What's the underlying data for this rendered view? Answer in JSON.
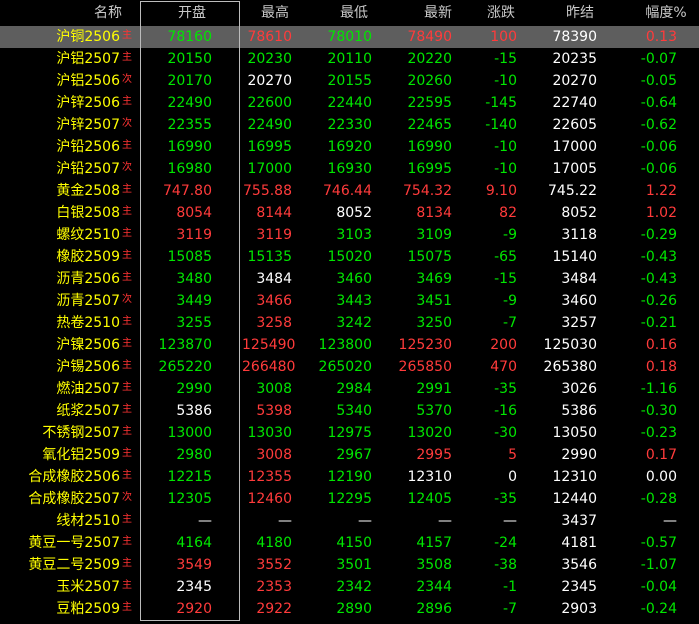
{
  "colors": {
    "background": "#000000",
    "name": "#ffff00",
    "up": "#ff3b3b",
    "down": "#00e600",
    "flat": "#ffffff",
    "tag": "#ff3333",
    "header": "#c8c8c8",
    "selected_row": "#5e5e5e"
  },
  "columns": {
    "name": "名称",
    "open": "开盘",
    "high": "最高",
    "low": "最低",
    "last": "最新",
    "change": "涨跌",
    "prev_close": "昨结",
    "pct": "幅度%"
  },
  "selected_row_index": 0,
  "rows": [
    {
      "name": "沪铜2506",
      "tag": "主",
      "open": "78160",
      "open_c": "down",
      "high": "78610",
      "high_c": "up",
      "low": "78010",
      "low_c": "down",
      "last": "78490",
      "last_c": "up",
      "change": "100",
      "change_c": "up",
      "prev": "78390",
      "pct": "0.13",
      "pct_c": "up"
    },
    {
      "name": "沪铝2507",
      "tag": "主",
      "open": "20150",
      "open_c": "down",
      "high": "20230",
      "high_c": "down",
      "low": "20110",
      "low_c": "down",
      "last": "20220",
      "last_c": "down",
      "change": "-15",
      "change_c": "down",
      "prev": "20235",
      "pct": "-0.07",
      "pct_c": "down"
    },
    {
      "name": "沪铝2506",
      "tag": "次",
      "open": "20170",
      "open_c": "down",
      "high": "20270",
      "high_c": "flat",
      "low": "20155",
      "low_c": "down",
      "last": "20260",
      "last_c": "down",
      "change": "-10",
      "change_c": "down",
      "prev": "20270",
      "pct": "-0.05",
      "pct_c": "down"
    },
    {
      "name": "沪锌2506",
      "tag": "主",
      "open": "22490",
      "open_c": "down",
      "high": "22600",
      "high_c": "down",
      "low": "22440",
      "low_c": "down",
      "last": "22595",
      "last_c": "down",
      "change": "-145",
      "change_c": "down",
      "prev": "22740",
      "pct": "-0.64",
      "pct_c": "down"
    },
    {
      "name": "沪锌2507",
      "tag": "次",
      "open": "22355",
      "open_c": "down",
      "high": "22490",
      "high_c": "down",
      "low": "22330",
      "low_c": "down",
      "last": "22465",
      "last_c": "down",
      "change": "-140",
      "change_c": "down",
      "prev": "22605",
      "pct": "-0.62",
      "pct_c": "down"
    },
    {
      "name": "沪铅2506",
      "tag": "主",
      "open": "16990",
      "open_c": "down",
      "high": "16995",
      "high_c": "down",
      "low": "16920",
      "low_c": "down",
      "last": "16990",
      "last_c": "down",
      "change": "-10",
      "change_c": "down",
      "prev": "17000",
      "pct": "-0.06",
      "pct_c": "down"
    },
    {
      "name": "沪铅2507",
      "tag": "次",
      "open": "16980",
      "open_c": "down",
      "high": "17000",
      "high_c": "down",
      "low": "16930",
      "low_c": "down",
      "last": "16995",
      "last_c": "down",
      "change": "-10",
      "change_c": "down",
      "prev": "17005",
      "pct": "-0.06",
      "pct_c": "down"
    },
    {
      "name": "黄金2508",
      "tag": "主",
      "open": "747.80",
      "open_c": "up",
      "high": "755.88",
      "high_c": "up",
      "low": "746.44",
      "low_c": "up",
      "last": "754.32",
      "last_c": "up",
      "change": "9.10",
      "change_c": "up",
      "prev": "745.22",
      "pct": "1.22",
      "pct_c": "up"
    },
    {
      "name": "白银2508",
      "tag": "主",
      "open": "8054",
      "open_c": "up",
      "high": "8144",
      "high_c": "up",
      "low": "8052",
      "low_c": "flat",
      "last": "8134",
      "last_c": "up",
      "change": "82",
      "change_c": "up",
      "prev": "8052",
      "pct": "1.02",
      "pct_c": "up"
    },
    {
      "name": "螺纹2510",
      "tag": "主",
      "open": "3119",
      "open_c": "up",
      "high": "3119",
      "high_c": "up",
      "low": "3103",
      "low_c": "down",
      "last": "3109",
      "last_c": "down",
      "change": "-9",
      "change_c": "down",
      "prev": "3118",
      "pct": "-0.29",
      "pct_c": "down"
    },
    {
      "name": "橡胶2509",
      "tag": "主",
      "open": "15085",
      "open_c": "down",
      "high": "15135",
      "high_c": "down",
      "low": "15020",
      "low_c": "down",
      "last": "15075",
      "last_c": "down",
      "change": "-65",
      "change_c": "down",
      "prev": "15140",
      "pct": "-0.43",
      "pct_c": "down"
    },
    {
      "name": "沥青2506",
      "tag": "主",
      "open": "3480",
      "open_c": "down",
      "high": "3484",
      "high_c": "flat",
      "low": "3460",
      "low_c": "down",
      "last": "3469",
      "last_c": "down",
      "change": "-15",
      "change_c": "down",
      "prev": "3484",
      "pct": "-0.43",
      "pct_c": "down"
    },
    {
      "name": "沥青2507",
      "tag": "次",
      "open": "3449",
      "open_c": "down",
      "high": "3466",
      "high_c": "up",
      "low": "3443",
      "low_c": "down",
      "last": "3451",
      "last_c": "down",
      "change": "-9",
      "change_c": "down",
      "prev": "3460",
      "pct": "-0.26",
      "pct_c": "down"
    },
    {
      "name": "热卷2510",
      "tag": "主",
      "open": "3255",
      "open_c": "down",
      "high": "3258",
      "high_c": "up",
      "low": "3242",
      "low_c": "down",
      "last": "3250",
      "last_c": "down",
      "change": "-7",
      "change_c": "down",
      "prev": "3257",
      "pct": "-0.21",
      "pct_c": "down"
    },
    {
      "name": "沪镍2506",
      "tag": "主",
      "open": "123870",
      "open_c": "down",
      "high": "125490",
      "high_c": "up",
      "low": "123800",
      "low_c": "down",
      "last": "125230",
      "last_c": "up",
      "change": "200",
      "change_c": "up",
      "prev": "125030",
      "pct": "0.16",
      "pct_c": "up"
    },
    {
      "name": "沪锡2506",
      "tag": "主",
      "open": "265220",
      "open_c": "down",
      "high": "266480",
      "high_c": "up",
      "low": "265020",
      "low_c": "down",
      "last": "265850",
      "last_c": "up",
      "change": "470",
      "change_c": "up",
      "prev": "265380",
      "pct": "0.18",
      "pct_c": "up"
    },
    {
      "name": "燃油2507",
      "tag": "主",
      "open": "2990",
      "open_c": "down",
      "high": "3008",
      "high_c": "down",
      "low": "2984",
      "low_c": "down",
      "last": "2991",
      "last_c": "down",
      "change": "-35",
      "change_c": "down",
      "prev": "3026",
      "pct": "-1.16",
      "pct_c": "down"
    },
    {
      "name": "纸浆2507",
      "tag": "主",
      "open": "5386",
      "open_c": "flat",
      "high": "5398",
      "high_c": "up",
      "low": "5340",
      "low_c": "down",
      "last": "5370",
      "last_c": "down",
      "change": "-16",
      "change_c": "down",
      "prev": "5386",
      "pct": "-0.30",
      "pct_c": "down"
    },
    {
      "name": "不锈钢2507",
      "tag": "主",
      "open": "13000",
      "open_c": "down",
      "high": "13030",
      "high_c": "down",
      "low": "12975",
      "low_c": "down",
      "last": "13020",
      "last_c": "down",
      "change": "-30",
      "change_c": "down",
      "prev": "13050",
      "pct": "-0.23",
      "pct_c": "down"
    },
    {
      "name": "氧化铝2509",
      "tag": "主",
      "open": "2980",
      "open_c": "down",
      "high": "3008",
      "high_c": "up",
      "low": "2967",
      "low_c": "down",
      "last": "2995",
      "last_c": "up",
      "change": "5",
      "change_c": "up",
      "prev": "2990",
      "pct": "0.17",
      "pct_c": "up"
    },
    {
      "name": "合成橡胶2506",
      "tag": "主",
      "open": "12215",
      "open_c": "down",
      "high": "12355",
      "high_c": "up",
      "low": "12190",
      "low_c": "down",
      "last": "12310",
      "last_c": "flat",
      "change": "0",
      "change_c": "flat",
      "prev": "12310",
      "pct": "0.00",
      "pct_c": "flat"
    },
    {
      "name": "合成橡胶2507",
      "tag": "次",
      "open": "12305",
      "open_c": "down",
      "high": "12460",
      "high_c": "up",
      "low": "12295",
      "low_c": "down",
      "last": "12405",
      "last_c": "down",
      "change": "-35",
      "change_c": "down",
      "prev": "12440",
      "pct": "-0.28",
      "pct_c": "down"
    },
    {
      "name": "线材2510",
      "tag": "主",
      "open": "—",
      "open_c": "flat",
      "high": "—",
      "high_c": "flat",
      "low": "—",
      "low_c": "flat",
      "last": "—",
      "last_c": "flat",
      "change": "—",
      "change_c": "flat",
      "prev": "3437",
      "pct": "—",
      "pct_c": "flat"
    },
    {
      "name": "黄豆一号2507",
      "tag": "主",
      "open": "4164",
      "open_c": "down",
      "high": "4180",
      "high_c": "down",
      "low": "4150",
      "low_c": "down",
      "last": "4157",
      "last_c": "down",
      "change": "-24",
      "change_c": "down",
      "prev": "4181",
      "pct": "-0.57",
      "pct_c": "down"
    },
    {
      "name": "黄豆二号2509",
      "tag": "主",
      "open": "3549",
      "open_c": "up",
      "high": "3552",
      "high_c": "up",
      "low": "3501",
      "low_c": "down",
      "last": "3508",
      "last_c": "down",
      "change": "-38",
      "change_c": "down",
      "prev": "3546",
      "pct": "-1.07",
      "pct_c": "down"
    },
    {
      "name": "玉米2507",
      "tag": "主",
      "open": "2345",
      "open_c": "flat",
      "high": "2353",
      "high_c": "up",
      "low": "2342",
      "low_c": "down",
      "last": "2344",
      "last_c": "down",
      "change": "-1",
      "change_c": "down",
      "prev": "2345",
      "pct": "-0.04",
      "pct_c": "down"
    },
    {
      "name": "豆粕2509",
      "tag": "主",
      "open": "2920",
      "open_c": "up",
      "high": "2922",
      "high_c": "up",
      "low": "2890",
      "low_c": "down",
      "last": "2896",
      "last_c": "down",
      "change": "-7",
      "change_c": "down",
      "prev": "2903",
      "pct": "-0.24",
      "pct_c": "down"
    }
  ]
}
